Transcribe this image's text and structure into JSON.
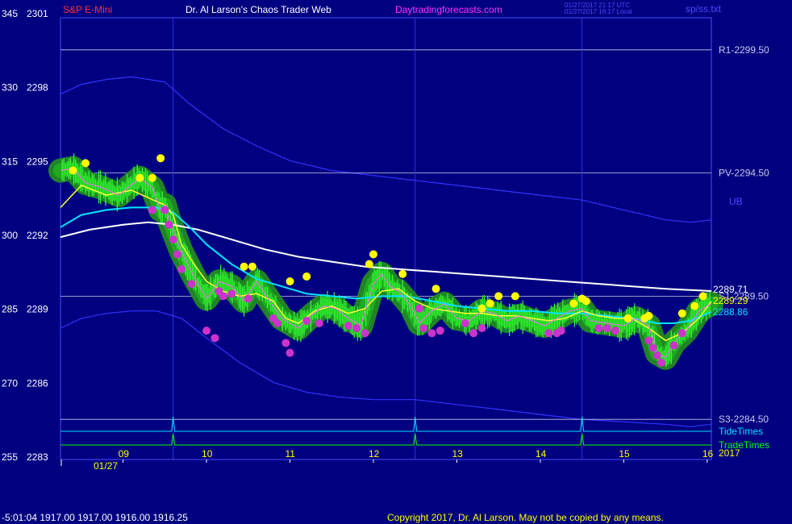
{
  "header": {
    "symbol": "S&P E-Mini",
    "title": "Dr. Al Larson's Chaos Trader Web",
    "site": "Daytradingforecasts.com",
    "time_utc": "01/27/2017 21:17 UTC",
    "time_local": "01/27/2017 16:17 Local",
    "file": "sp/ss.txt"
  },
  "footer": {
    "ohlc": "-5:01:04  1917.00 1917.00 1916.00 1916.25",
    "copyright": "Copyright 2017, Dr. Al Larson. May not be copied by any means."
  },
  "date_label": "01/27",
  "year_label": "2017",
  "chart_data": {
    "type": "line",
    "title": "",
    "x_axis": {
      "label": "",
      "ticks": [
        "09",
        "10",
        "11",
        "12",
        "13",
        "14",
        "15",
        "16"
      ],
      "range_hours": [
        8.25,
        16.05
      ]
    },
    "y_axis": {
      "left_ticks": [
        {
          "osc": "345",
          "price": "2301"
        },
        {
          "osc": "330",
          "price": "2298"
        },
        {
          "osc": "315",
          "price": "2295"
        },
        {
          "osc": "300",
          "price": "2292"
        },
        {
          "osc": "285",
          "price": "2289"
        },
        {
          "osc": "270",
          "price": "2286"
        },
        {
          "osc": "255",
          "price": "2283"
        }
      ],
      "range": [
        2283,
        2301
      ]
    },
    "horizontal_levels": [
      {
        "label": "R1-2299.50",
        "value": 2299.5
      },
      {
        "label": "PV-2294.50",
        "value": 2294.5
      },
      {
        "label": "S1-2289.50",
        "value": 2289.5
      },
      {
        "label": "S3-2284.50",
        "value": 2284.5
      }
    ],
    "band_label": "UB",
    "end_values": [
      {
        "label": "2289.71",
        "color": "#ffffff"
      },
      {
        "label": "2289.29",
        "color": "#ffff00"
      },
      {
        "label": "2288.86",
        "color": "#00e5ff"
      }
    ],
    "cycle_labels": [
      {
        "label": "TideTimes",
        "color": "#00e5ff"
      },
      {
        "label": "TradeTimes",
        "color": "#00ff00"
      }
    ],
    "tide_times_hours": [
      9.6,
      12.5,
      14.5
    ],
    "price_series": {
      "hours": [
        8.25,
        8.4,
        8.55,
        8.75,
        8.95,
        9.2,
        9.35,
        9.45,
        9.5,
        9.55,
        9.7,
        9.85,
        10.0,
        10.15,
        10.3,
        10.45,
        10.6,
        10.7,
        10.8,
        10.9,
        11.0,
        11.1,
        11.25,
        11.4,
        11.55,
        11.7,
        11.85,
        12.0,
        12.1,
        12.2,
        12.3,
        12.45,
        12.55,
        12.7,
        12.85,
        13.0,
        13.15,
        13.3,
        13.45,
        13.6,
        13.75,
        13.9,
        14.05,
        14.2,
        14.35,
        14.5,
        14.6,
        14.8,
        15.0,
        15.15,
        15.3,
        15.4,
        15.5,
        15.6,
        15.75,
        15.9,
        16.05
      ],
      "values": [
        2294.6,
        2294.7,
        2294.1,
        2293.9,
        2293.6,
        2294.3,
        2293.9,
        2293.0,
        2293.2,
        2292.6,
        2291.3,
        2290.3,
        2289.4,
        2290.1,
        2289.9,
        2289.3,
        2290.1,
        2289.6,
        2289.1,
        2288.6,
        2288.4,
        2288.2,
        2288.7,
        2289.1,
        2289.0,
        2288.6,
        2288.3,
        2290.0,
        2290.4,
        2289.9,
        2289.7,
        2289.1,
        2288.4,
        2288.9,
        2289.2,
        2288.6,
        2288.5,
        2288.9,
        2288.8,
        2288.5,
        2288.7,
        2288.5,
        2288.3,
        2288.6,
        2288.9,
        2289.0,
        2288.5,
        2288.4,
        2288.3,
        2288.6,
        2288.3,
        2287.2,
        2287.0,
        2287.6,
        2288.1,
        2288.9,
        2289.2
      ]
    },
    "yellow_ma": {
      "hours": [
        8.25,
        8.5,
        8.8,
        9.1,
        9.3,
        9.5,
        9.6,
        9.7,
        9.85,
        10.0,
        10.2,
        10.4,
        10.6,
        10.8,
        10.95,
        11.1,
        11.3,
        11.5,
        11.7,
        11.9,
        12.1,
        12.3,
        12.5,
        12.7,
        12.9,
        13.1,
        13.3,
        13.5,
        13.7,
        13.9,
        14.1,
        14.3,
        14.5,
        14.7,
        14.9,
        15.1,
        15.3,
        15.5,
        15.7,
        15.9,
        16.05
      ],
      "values": [
        2293.1,
        2294.0,
        2293.6,
        2293.8,
        2293.5,
        2293.2,
        2292.8,
        2291.6,
        2290.8,
        2290.1,
        2289.7,
        2289.5,
        2289.6,
        2289.3,
        2288.6,
        2288.4,
        2288.9,
        2289.1,
        2288.8,
        2289.0,
        2289.7,
        2289.8,
        2289.3,
        2289.0,
        2288.9,
        2288.8,
        2288.8,
        2288.7,
        2288.7,
        2288.6,
        2288.5,
        2288.6,
        2288.9,
        2288.7,
        2288.6,
        2288.6,
        2288.2,
        2287.7,
        2288.0,
        2288.6,
        2289.29
      ]
    },
    "cyan_ma": {
      "hours": [
        8.25,
        8.5,
        8.8,
        9.1,
        9.4,
        9.6,
        9.8,
        10.0,
        10.3,
        10.6,
        10.9,
        11.2,
        11.5,
        11.8,
        12.1,
        12.4,
        12.7,
        13.0,
        13.3,
        13.6,
        13.9,
        14.2,
        14.5,
        14.8,
        15.1,
        15.4,
        15.6,
        15.8,
        16.05
      ],
      "values": [
        2292.3,
        2292.8,
        2293.0,
        2293.1,
        2293.1,
        2292.9,
        2292.3,
        2291.6,
        2290.8,
        2290.2,
        2289.9,
        2289.6,
        2289.5,
        2289.4,
        2289.5,
        2289.5,
        2289.3,
        2289.1,
        2289.0,
        2288.9,
        2288.9,
        2288.8,
        2288.8,
        2288.7,
        2288.6,
        2288.4,
        2288.4,
        2288.5,
        2288.86
      ]
    },
    "white_ma": {
      "hours": [
        8.25,
        8.6,
        9.0,
        9.3,
        9.6,
        9.9,
        10.3,
        10.7,
        11.1,
        11.5,
        11.9,
        12.3,
        12.7,
        13.1,
        13.5,
        13.9,
        14.3,
        14.7,
        15.1,
        15.5,
        15.8,
        16.05
      ],
      "values": [
        2291.9,
        2292.2,
        2292.4,
        2292.5,
        2292.4,
        2292.2,
        2291.8,
        2291.4,
        2291.1,
        2290.9,
        2290.7,
        2290.6,
        2290.5,
        2290.4,
        2290.3,
        2290.2,
        2290.1,
        2290.0,
        2289.9,
        2289.8,
        2289.75,
        2289.71
      ]
    },
    "upper_band": {
      "hours": [
        8.25,
        8.5,
        8.8,
        9.1,
        9.3,
        9.5,
        9.8,
        10.2,
        10.6,
        11.0,
        11.5,
        12.0,
        12.5,
        13.0,
        13.5,
        14.0,
        14.5,
        15.0,
        15.5,
        15.8,
        16.05
      ],
      "values": [
        2297.7,
        2298.1,
        2298.3,
        2298.4,
        2298.3,
        2298.2,
        2297.3,
        2296.3,
        2295.6,
        2295.0,
        2294.6,
        2294.4,
        2294.2,
        2294.0,
        2293.8,
        2293.6,
        2293.4,
        2293.0,
        2292.6,
        2292.5,
        2292.6
      ]
    },
    "lower_band": {
      "hours": [
        8.25,
        8.5,
        8.8,
        9.1,
        9.4,
        9.7,
        10.0,
        10.4,
        10.8,
        11.2,
        11.6,
        12.0,
        12.5,
        13.0,
        13.5,
        14.0,
        14.5,
        15.0,
        15.5,
        15.8,
        16.05
      ],
      "values": [
        2288.2,
        2288.6,
        2288.8,
        2288.9,
        2288.9,
        2288.6,
        2287.8,
        2286.8,
        2286.0,
        2285.6,
        2285.4,
        2285.3,
        2285.3,
        2285.1,
        2284.9,
        2284.7,
        2284.5,
        2284.4,
        2284.3,
        2284.2,
        2284.3
      ]
    },
    "yellow_dots": {
      "hours": [
        8.4,
        8.55,
        9.2,
        9.35,
        9.45,
        10.45,
        10.55,
        11.0,
        11.2,
        12.0,
        11.95,
        12.35,
        12.75,
        13.4,
        13.5,
        13.7,
        13.3,
        14.4,
        14.5,
        14.55,
        15.05,
        15.25,
        15.3,
        15.7,
        15.85,
        15.95
      ],
      "values": [
        2294.6,
        2294.9,
        2294.3,
        2294.3,
        2295.1,
        2290.7,
        2290.7,
        2290.1,
        2290.3,
        2291.2,
        2290.8,
        2290.4,
        2289.8,
        2289.2,
        2289.5,
        2289.5,
        2289.0,
        2289.2,
        2289.4,
        2289.3,
        2288.6,
        2288.6,
        2288.7,
        2288.8,
        2289.1,
        2289.5
      ]
    },
    "magenta_dots": {
      "hours": [
        9.35,
        9.5,
        9.55,
        9.6,
        9.65,
        9.7,
        10.0,
        10.1,
        9.82,
        10.15,
        10.2,
        10.3,
        10.5,
        10.8,
        10.85,
        10.95,
        11.0,
        11.2,
        11.35,
        11.7,
        11.8,
        11.9,
        12.55,
        12.6,
        12.7,
        12.8,
        13.1,
        13.2,
        13.3,
        14.1,
        14.2,
        14.25,
        14.7,
        14.8,
        14.9,
        15.3,
        15.35,
        15.4,
        15.45,
        15.6,
        15.7
      ],
      "values": [
        2293.0,
        2293.0,
        2292.4,
        2291.8,
        2291.2,
        2290.6,
        2288.1,
        2287.8,
        2290.0,
        2289.7,
        2289.5,
        2289.6,
        2289.4,
        2288.6,
        2288.4,
        2287.6,
        2287.2,
        2288.5,
        2288.4,
        2288.3,
        2288.2,
        2288.0,
        2289.0,
        2288.2,
        2288.0,
        2288.1,
        2288.4,
        2288.0,
        2288.2,
        2288.0,
        2288.0,
        2288.1,
        2288.2,
        2288.2,
        2288.1,
        2287.7,
        2287.4,
        2287.1,
        2286.8,
        2287.5,
        2288.0
      ]
    }
  }
}
